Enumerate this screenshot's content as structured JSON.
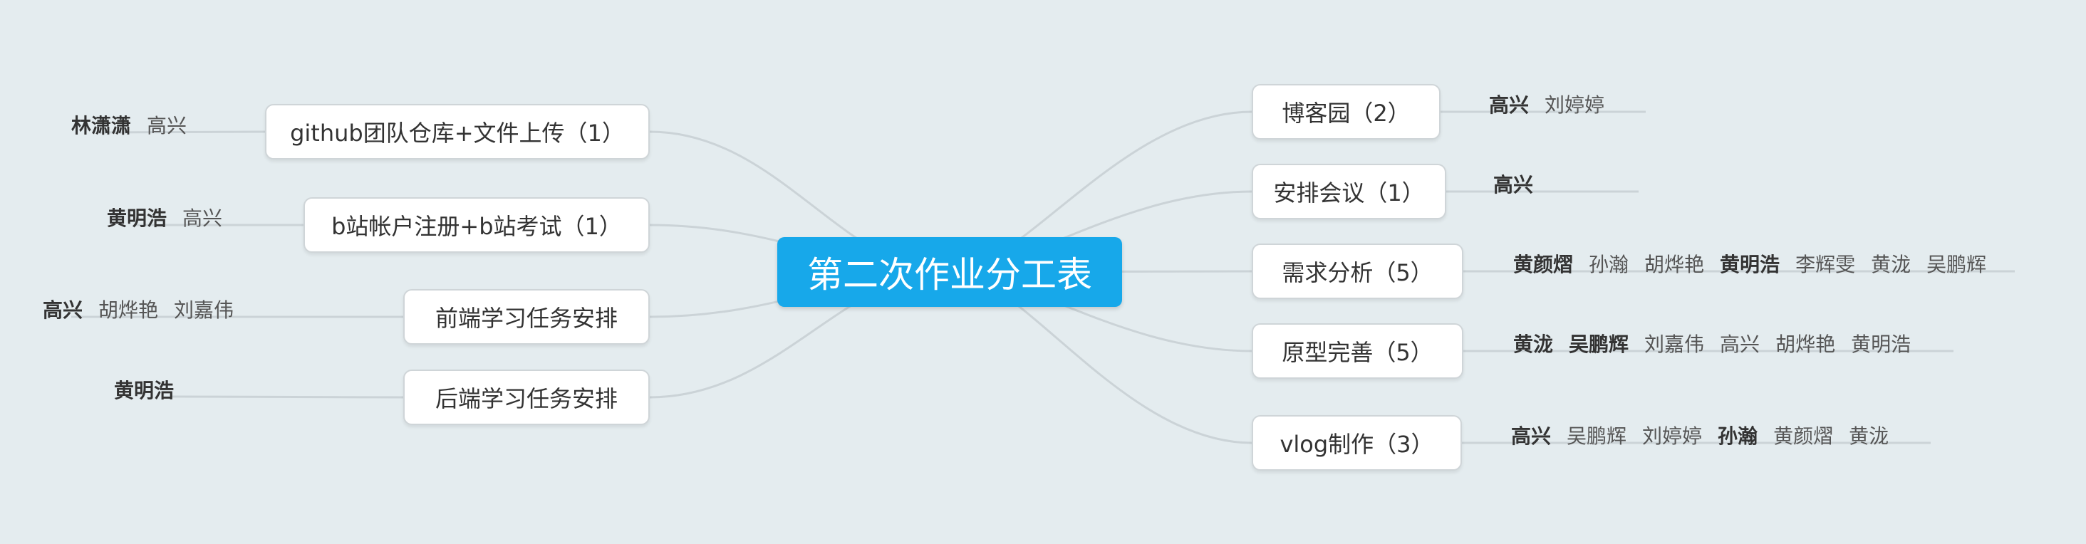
{
  "center": {
    "title": "第二次作业分工表"
  },
  "left_topics": [
    {
      "label": "github团队仓库+文件上传（1）",
      "members": [
        {
          "name": "林潇潇",
          "bold": true
        },
        {
          "name": "高兴",
          "bold": false
        }
      ]
    },
    {
      "label": "b站帐户注册+b站考试（1）",
      "members": [
        {
          "name": "黄明浩",
          "bold": true
        },
        {
          "name": "高兴",
          "bold": false
        }
      ]
    },
    {
      "label": "前端学习任务安排",
      "members": [
        {
          "name": "高兴",
          "bold": true
        },
        {
          "name": "胡烨艳",
          "bold": false
        },
        {
          "name": "刘嘉伟",
          "bold": false
        }
      ]
    },
    {
      "label": "后端学习任务安排",
      "members": [
        {
          "name": "黄明浩",
          "bold": true
        }
      ]
    }
  ],
  "right_topics": [
    {
      "label": "博客园（2）",
      "members": [
        {
          "name": "高兴",
          "bold": true
        },
        {
          "name": "刘婷婷",
          "bold": false
        }
      ]
    },
    {
      "label": "安排会议（1）",
      "members": [
        {
          "name": "高兴",
          "bold": true
        }
      ]
    },
    {
      "label": "需求分析（5）",
      "members": [
        {
          "name": "黄颜熠",
          "bold": true
        },
        {
          "name": "孙瀚",
          "bold": false
        },
        {
          "name": "胡烨艳",
          "bold": false
        },
        {
          "name": "黄明浩",
          "bold": true
        },
        {
          "name": "李辉雯",
          "bold": false
        },
        {
          "name": "黄泷",
          "bold": false
        },
        {
          "name": "吴鹏辉",
          "bold": false
        }
      ]
    },
    {
      "label": "原型完善（5）",
      "members": [
        {
          "name": "黄泷",
          "bold": true
        },
        {
          "name": "吴鹏辉",
          "bold": true
        },
        {
          "name": "刘嘉伟",
          "bold": false
        },
        {
          "name": "高兴",
          "bold": false
        },
        {
          "name": "胡烨艳",
          "bold": false
        },
        {
          "name": "黄明浩",
          "bold": false
        }
      ]
    },
    {
      "label": "vlog制作（3）",
      "members": [
        {
          "name": "高兴",
          "bold": true
        },
        {
          "name": "吴鹏辉",
          "bold": false
        },
        {
          "name": "刘婷婷",
          "bold": false
        },
        {
          "name": "孙瀚",
          "bold": true
        },
        {
          "name": "黄颜熠",
          "bold": false
        },
        {
          "name": "黄泷",
          "bold": false
        }
      ]
    }
  ],
  "colors": {
    "background": "#e4ecef",
    "center_fill": "#17a8ea",
    "line": "#cbd3d7"
  }
}
